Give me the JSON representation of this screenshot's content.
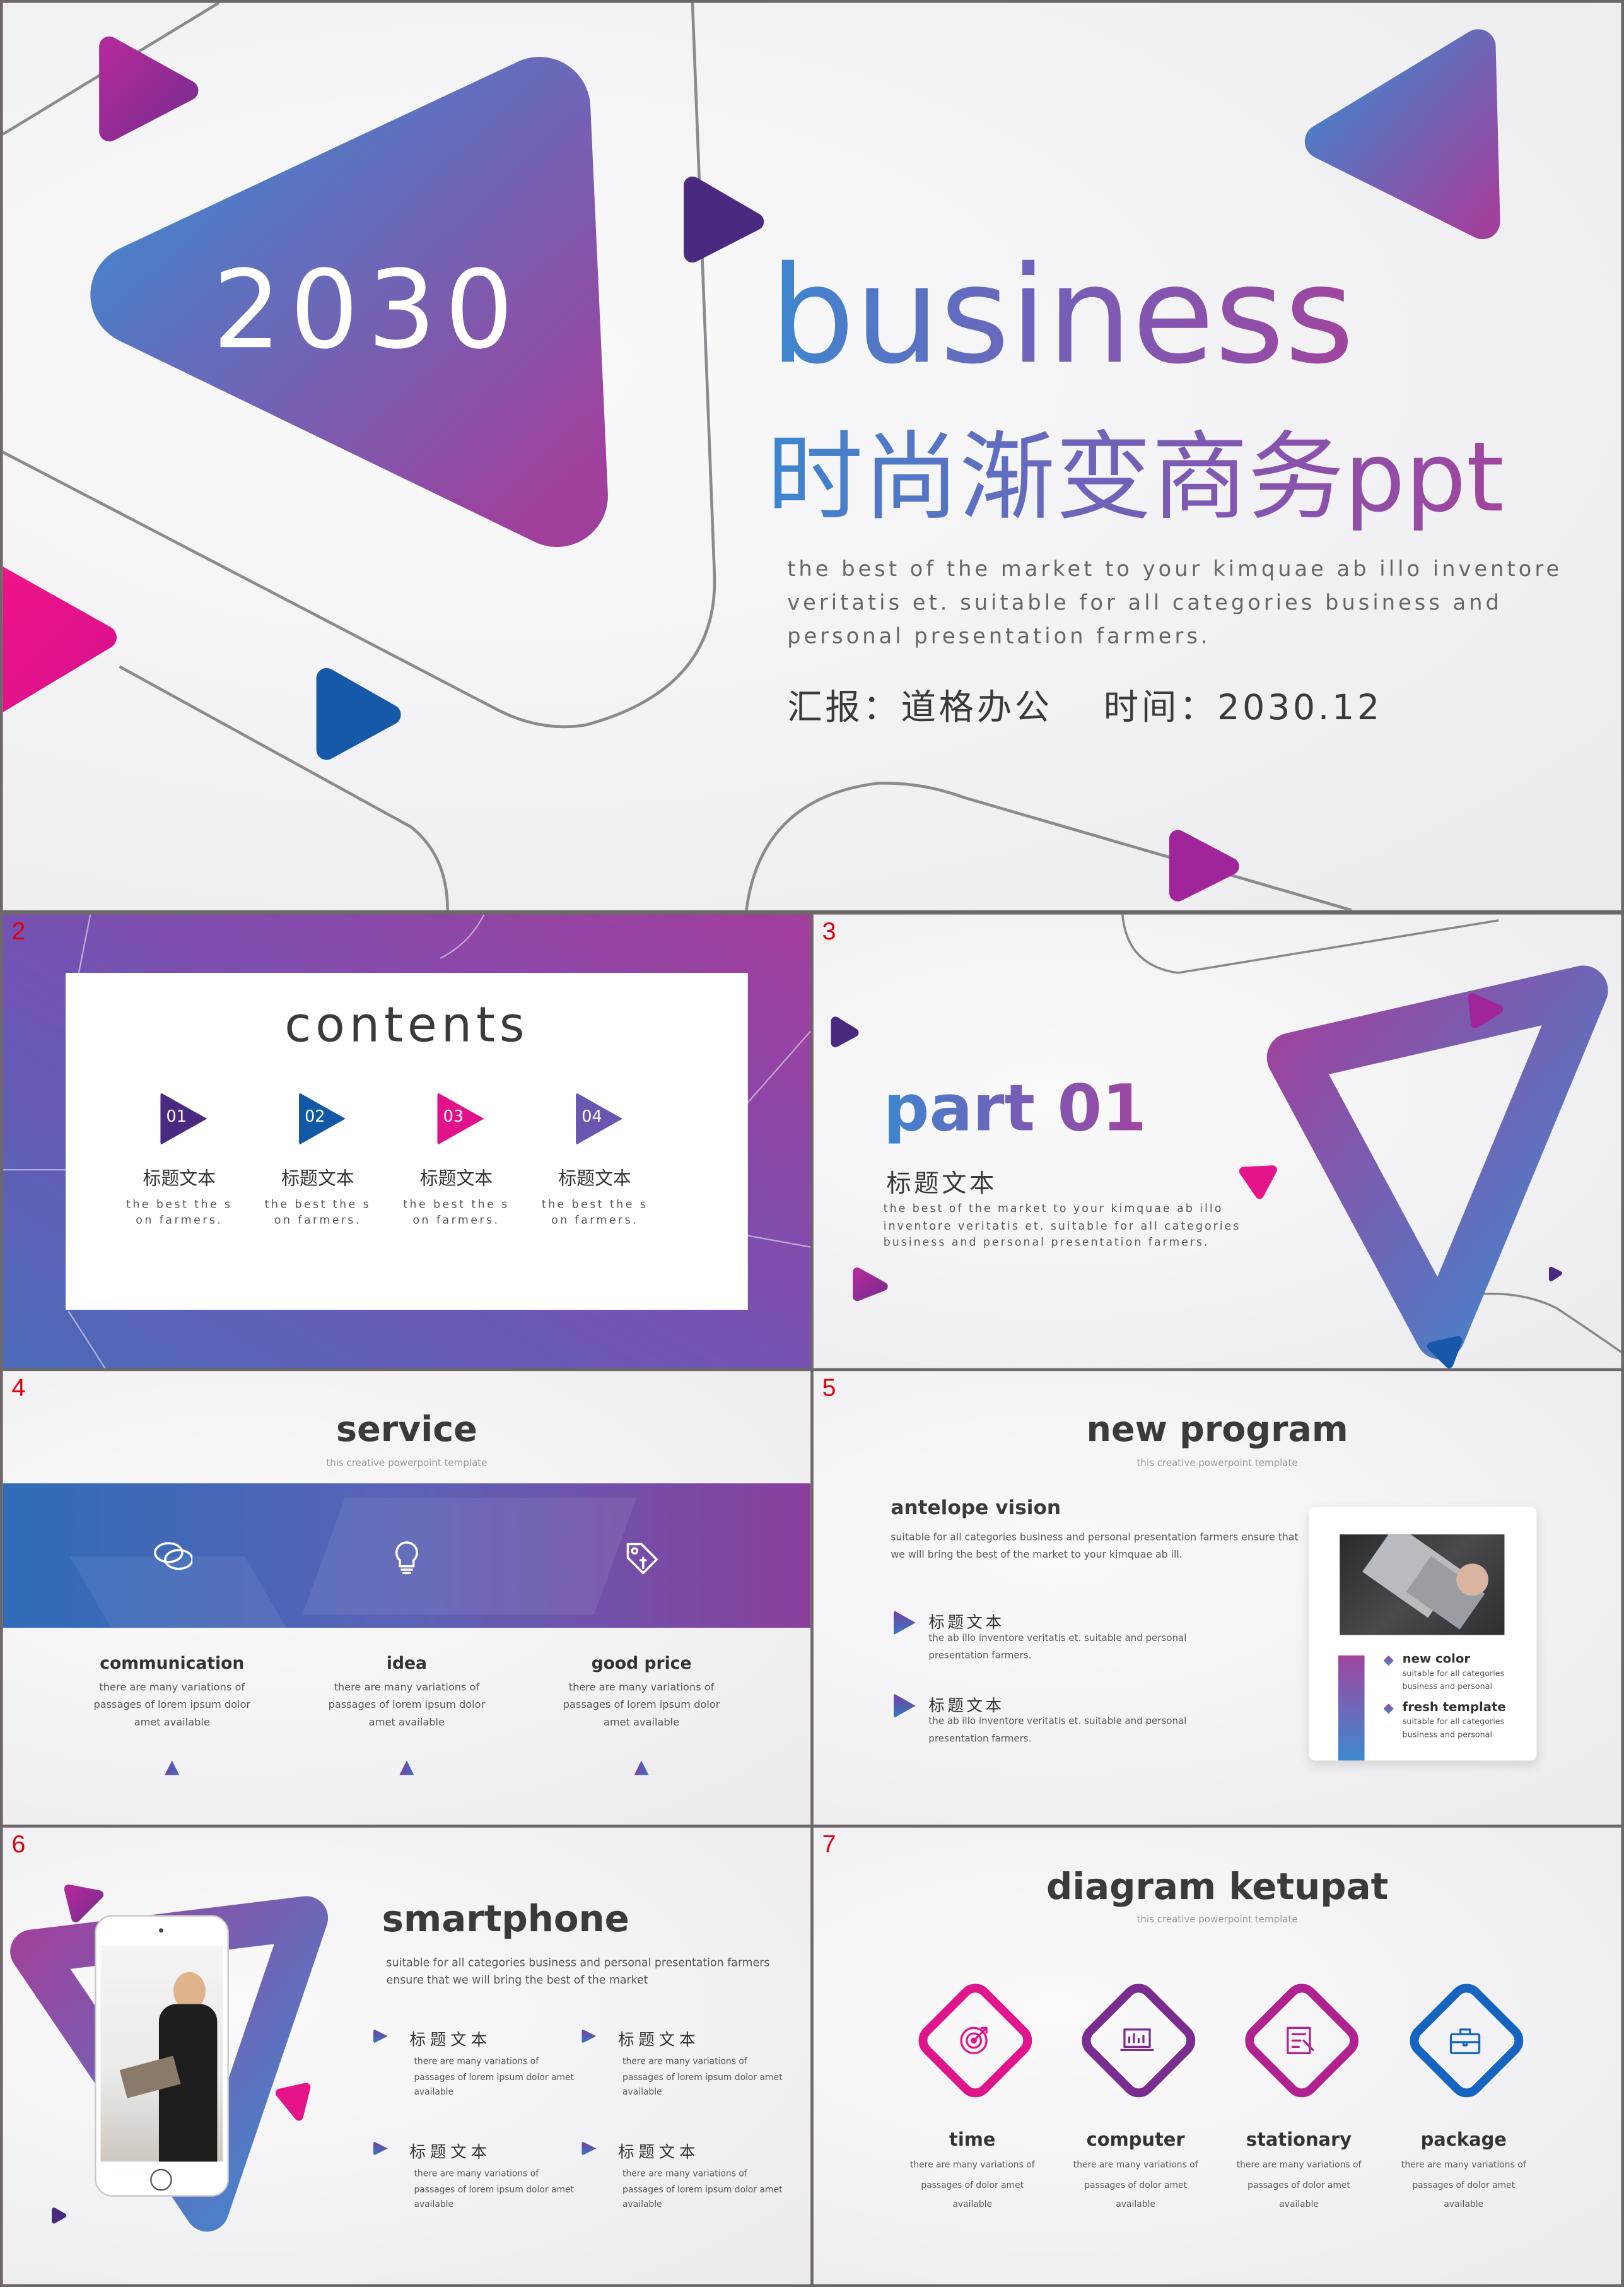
{
  "colors": {
    "blue": "#3d86cf",
    "purple": "#7a4fb0",
    "magenta": "#a0369c",
    "pink": "#e5148a",
    "navy": "#1859a8",
    "border": "#6e6769"
  },
  "slide1": {
    "year": "2030",
    "title_en": "business",
    "title_cn": "时尚渐变商务ppt",
    "desc": [
      "the best of the market to your kimquae ab illo inventore",
      "veritatis et. suitable for all categories business and",
      "personal presentation farmers."
    ],
    "reporter": "汇报：道格办公",
    "time": "时间：2030.12"
  },
  "slide2": {
    "number": "2",
    "heading": "contents",
    "items": [
      {
        "num": "01",
        "title": "标题文本",
        "line1": "the best the s",
        "line2": "on farmers.",
        "color": "#4a2a80"
      },
      {
        "num": "02",
        "title": "标题文本",
        "line1": "the best the s",
        "line2": "on farmers.",
        "color": "#1158a7"
      },
      {
        "num": "03",
        "title": "标题文本",
        "line1": "the best the s",
        "line2": "on farmers.",
        "color": "#e2108a"
      },
      {
        "num": "04",
        "title": "标题文本",
        "line1": "the best the s",
        "line2": "on farmers.",
        "color": "#6a55b0"
      }
    ]
  },
  "slide3": {
    "number": "3",
    "part": "part 01",
    "title": "标题文本",
    "desc": [
      "the best of the market to your kimquae ab illo",
      "inventore veritatis et. suitable for all categories",
      "business and personal presentation farmers."
    ]
  },
  "slide4": {
    "number": "4",
    "heading": "service",
    "subtitle": "this creative powerpoint template",
    "items": [
      {
        "icon": "chat-icon",
        "title": "communication",
        "lines": [
          "there are many variations of",
          "passages of lorem ipsum dolor",
          "amet available"
        ]
      },
      {
        "icon": "lightbulb-icon",
        "title": "idea",
        "lines": [
          "there are many variations of",
          "passages of lorem ipsum dolor",
          "amet available"
        ]
      },
      {
        "icon": "price-tag-icon",
        "title": "good price",
        "lines": [
          "there are many variations of",
          "passages of lorem ipsum dolor",
          "amet available"
        ]
      }
    ]
  },
  "slide5": {
    "number": "5",
    "heading": "new program",
    "subtitle": "this creative powerpoint template",
    "vision_title": "antelope vision",
    "vision_text": [
      "suitable for all categories business and personal presentation farmers ensure that",
      "we will bring the best of the market to your kimquae ab ill."
    ],
    "items": [
      {
        "title": "标题文本",
        "lines": [
          "the ab illo inventore veritatis et. suitable and personal",
          "presentation farmers."
        ]
      },
      {
        "title": "标题文本",
        "lines": [
          "the ab illo inventore veritatis et. suitable and personal",
          "presentation farmers."
        ]
      }
    ],
    "card": [
      {
        "title": "new color",
        "lines": [
          "suitable for all categories",
          "business and personal"
        ]
      },
      {
        "title": "fresh template",
        "lines": [
          "suitable for all categories",
          "business and personal"
        ]
      }
    ]
  },
  "slide6": {
    "number": "6",
    "heading": "smartphone",
    "desc": [
      "suitable for all categories business and personal presentation farmers",
      "ensure that we will bring the best of the market"
    ],
    "items": [
      {
        "title": "标题文本",
        "lines": [
          "there are many variations of",
          "passages of lorem ipsum dolor amet",
          "available"
        ]
      },
      {
        "title": "标题文本",
        "lines": [
          "there are many variations of",
          "passages of lorem ipsum dolor amet",
          "available"
        ]
      },
      {
        "title": "标题文本",
        "lines": [
          "there are many variations of",
          "passages of lorem ipsum dolor amet",
          "available"
        ]
      },
      {
        "title": "标题文本",
        "lines": [
          "there are many variations of",
          "passages of lorem ipsum dolor amet",
          "available"
        ]
      }
    ]
  },
  "slide7": {
    "number": "7",
    "heading": "diagram ketupat",
    "subtitle": "this creative powerpoint template",
    "items": [
      {
        "icon": "target-icon",
        "title": "time",
        "lines": [
          "there are many variations of",
          "passages of dolor amet",
          "available"
        ],
        "color": "#e0158c"
      },
      {
        "icon": "computer-icon",
        "title": "computer",
        "lines": [
          "there are many variations of",
          "passages of dolor amet",
          "available"
        ],
        "color": "#7a2c90"
      },
      {
        "icon": "stationary-icon",
        "title": "stationary",
        "lines": [
          "there are many variations of",
          "passages of dolor amet",
          "available"
        ],
        "color": "#b0228f"
      },
      {
        "icon": "briefcase-icon",
        "title": "package",
        "lines": [
          "there are many variations of",
          "passages of dolor amet",
          "available"
        ],
        "color": "#1565c0"
      }
    ]
  }
}
